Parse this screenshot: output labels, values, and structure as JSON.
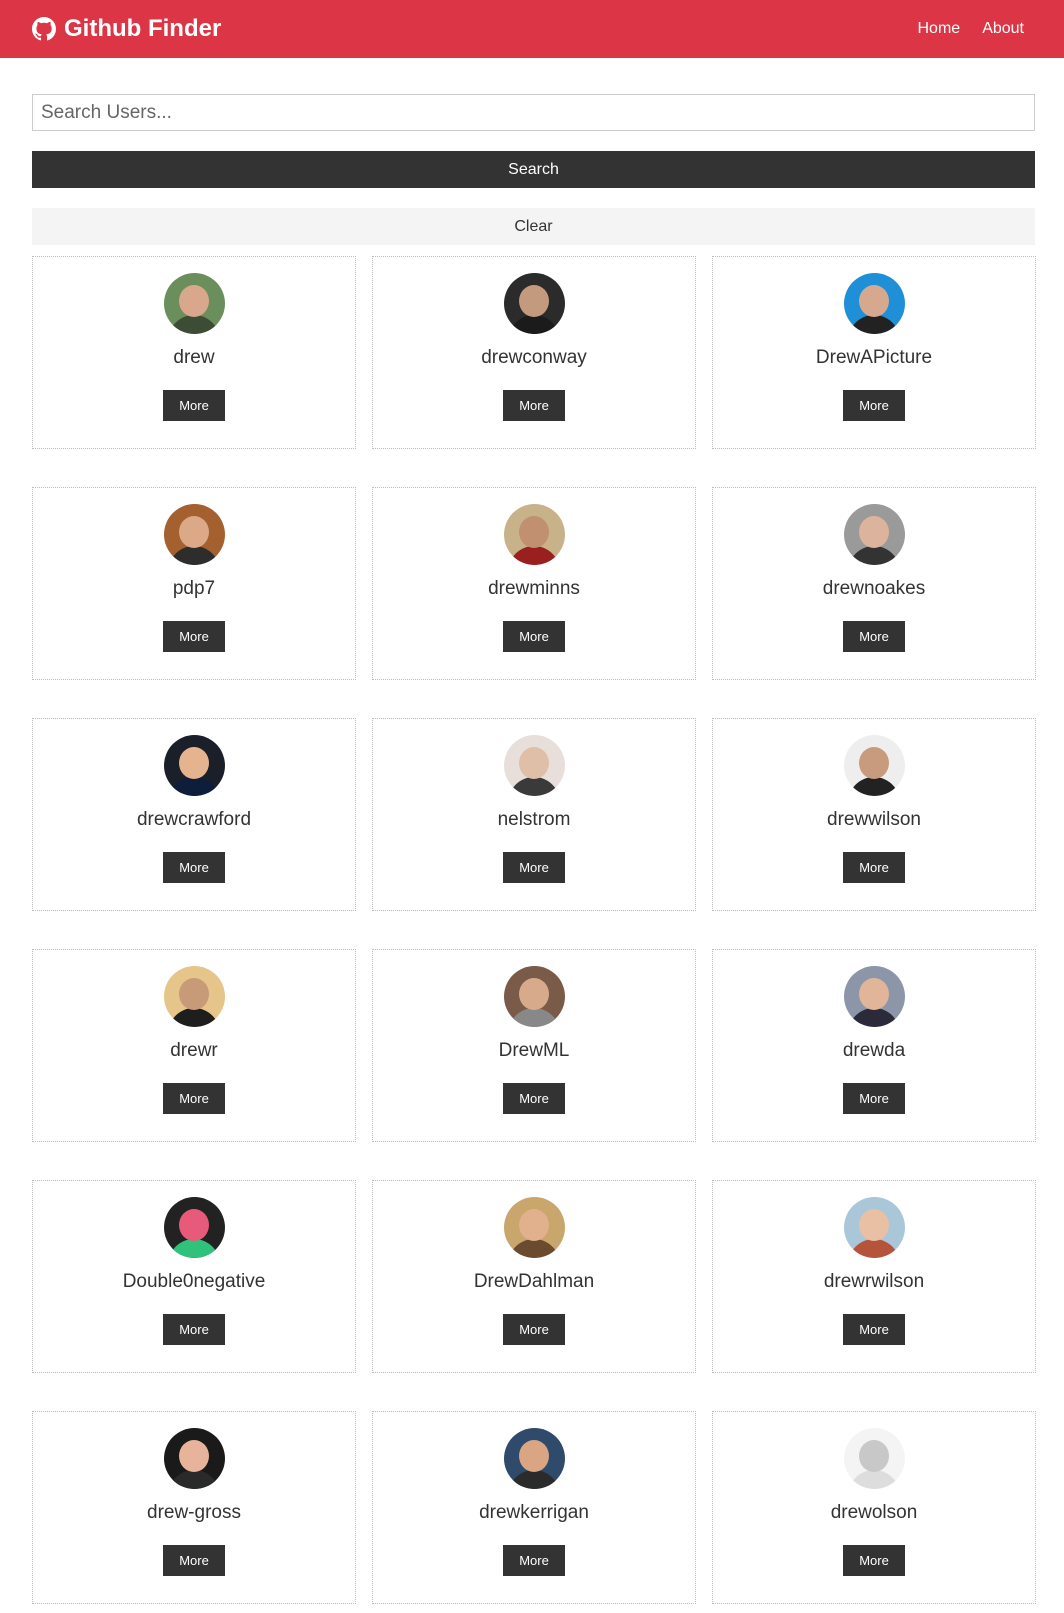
{
  "navbar": {
    "brand_icon": "github-icon",
    "brand": "Github Finder",
    "links": [
      "Home",
      "About"
    ]
  },
  "search": {
    "placeholder": "Search Users...",
    "value": "",
    "search_label": "Search",
    "clear_label": "Clear"
  },
  "colors": {
    "navbar": "#dc3545",
    "dark_button": "#333333",
    "light_button": "#f4f4f4"
  },
  "users": [
    {
      "login": "drew",
      "more_label": "More",
      "bg": "#6b8f5c",
      "skin": "#d9a78c",
      "shirt": "#3d4d35"
    },
    {
      "login": "drewconway",
      "more_label": "More",
      "bg": "#2b2b2b",
      "skin": "#c49a7e",
      "shirt": "#1b1b1b"
    },
    {
      "login": "DrewAPicture",
      "more_label": "More",
      "bg": "#1f8fd8",
      "skin": "#d6a98e",
      "shirt": "#222222"
    },
    {
      "login": "pdp7",
      "more_label": "More",
      "bg": "#a4602f",
      "skin": "#dba988",
      "shirt": "#2d2d2d"
    },
    {
      "login": "drewminns",
      "more_label": "More",
      "bg": "#c8b28a",
      "skin": "#c09070",
      "shirt": "#9a1f1f"
    },
    {
      "login": "drewnoakes",
      "more_label": "More",
      "bg": "#9a9a9a",
      "skin": "#dcb39c",
      "shirt": "#333333"
    },
    {
      "login": "drewcrawford",
      "more_label": "More",
      "bg": "#1a1f2a",
      "skin": "#e5b48e",
      "shirt": "#0f1d3d"
    },
    {
      "login": "nelstrom",
      "more_label": "More",
      "bg": "#e8dfdb",
      "skin": "#e0bfa8",
      "shirt": "#3a3a3a"
    },
    {
      "login": "drewwilson",
      "more_label": "More",
      "bg": "#eeeeee",
      "skin": "#c89b7f",
      "shirt": "#222222"
    },
    {
      "login": "drewr",
      "more_label": "More",
      "bg": "#e5c58a",
      "skin": "#c79a78",
      "shirt": "#1e1e1e"
    },
    {
      "login": "DrewML",
      "more_label": "More",
      "bg": "#7a5a48",
      "skin": "#d8aa8c",
      "shirt": "#888888"
    },
    {
      "login": "drewda",
      "more_label": "More",
      "bg": "#8d96a8",
      "skin": "#e0b59a",
      "shirt": "#2a2a3a"
    },
    {
      "login": "Double0negative",
      "more_label": "More",
      "bg": "#222222",
      "skin": "#e85a7a",
      "shirt": "#2fc27a"
    },
    {
      "login": "DrewDahlman",
      "more_label": "More",
      "bg": "#c9a66b",
      "skin": "#e1b08c",
      "shirt": "#6a4b2f"
    },
    {
      "login": "drewrwilson",
      "more_label": "More",
      "bg": "#a9c7d8",
      "skin": "#eac0a5",
      "shirt": "#b5543a"
    },
    {
      "login": "drew-gross",
      "more_label": "More",
      "bg": "#1a1a1a",
      "skin": "#e7b39a",
      "shirt": "#2a2a2a"
    },
    {
      "login": "drewkerrigan",
      "more_label": "More",
      "bg": "#2f4a6a",
      "skin": "#d9a583",
      "shirt": "#2b2b2b"
    },
    {
      "login": "drewolson",
      "more_label": "More",
      "bg": "#f4f4f4",
      "skin": "#c8c8c8",
      "shirt": "#dddddd"
    }
  ]
}
